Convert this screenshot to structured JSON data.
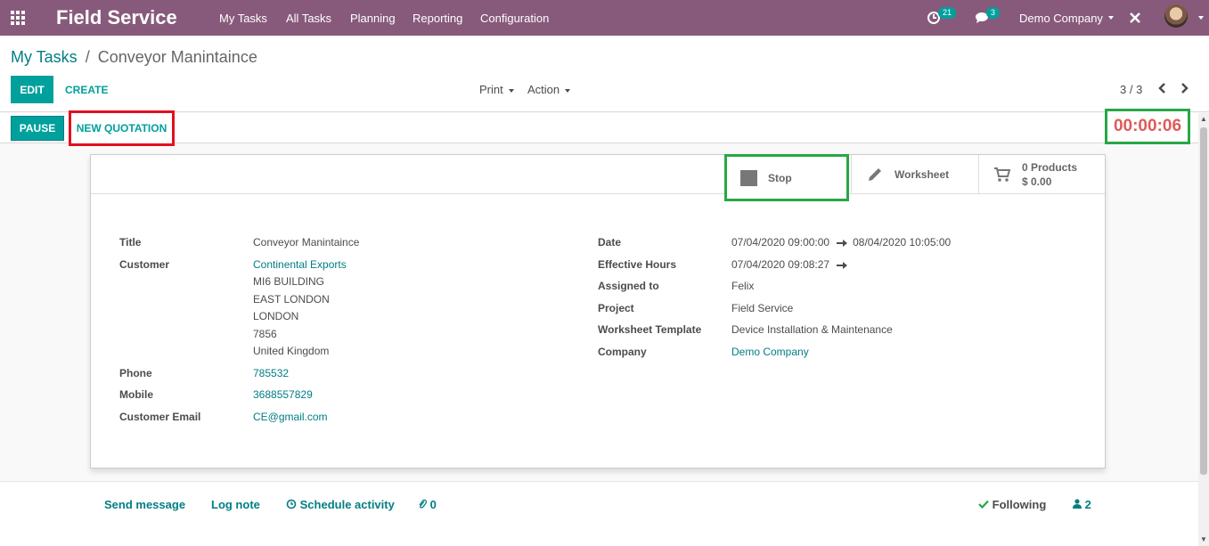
{
  "navbar": {
    "brand": "Field Service",
    "menu": [
      "My Tasks",
      "All Tasks",
      "Planning",
      "Reporting",
      "Configuration"
    ],
    "activity_count": "21",
    "message_count": "3",
    "company": "Demo Company"
  },
  "control_panel": {
    "breadcrumb_parent": "My Tasks",
    "breadcrumb_separator": "/",
    "breadcrumb_current": "Conveyor Manintaince",
    "edit_label": "EDIT",
    "create_label": "CREATE",
    "print_label": "Print",
    "action_label": "Action",
    "pager": "3 / 3"
  },
  "statusbar": {
    "pause_label": "PAUSE",
    "new_quotation_label": "NEW QUOTATION",
    "timer": "00:00:06"
  },
  "smart_buttons": {
    "stop_label": "Stop",
    "worksheet_label": "Worksheet",
    "products_count": "0 Products",
    "products_amount": "$ 0.00"
  },
  "left_fields": {
    "title_label": "Title",
    "title_value": "Conveyor Manintaince",
    "customer_label": "Customer",
    "customer_value": "Continental Exports",
    "address_lines": [
      "MI6 BUILDING",
      "EAST LONDON",
      "LONDON",
      "7856",
      "United Kingdom"
    ],
    "phone_label": "Phone",
    "phone_value": "785532",
    "mobile_label": "Mobile",
    "mobile_value": "3688557829",
    "email_label": "Customer Email",
    "email_value": "CE@gmail.com"
  },
  "right_fields": {
    "date_label": "Date",
    "date_start": "07/04/2020 09:00:00",
    "date_end": "08/04/2020 10:05:00",
    "effective_label": "Effective Hours",
    "effective_start": "07/04/2020 09:08:27",
    "assigned_label": "Assigned to",
    "assigned_value": "Felix",
    "project_label": "Project",
    "project_value": "Field Service",
    "template_label": "Worksheet Template",
    "template_value": "Device Installation & Maintenance",
    "company_label": "Company",
    "company_value": "Demo Company"
  },
  "chatter": {
    "send_message": "Send message",
    "log_note": "Log note",
    "schedule_activity": "Schedule activity",
    "attachments": "0",
    "following": "Following",
    "followers": "2"
  },
  "colors": {
    "navbar": "#875a7b",
    "primary": "#00a09d",
    "link": "#017e84",
    "timer": "#e05a5a",
    "highlight_red": "#e3101f",
    "highlight_green": "#28a745"
  }
}
